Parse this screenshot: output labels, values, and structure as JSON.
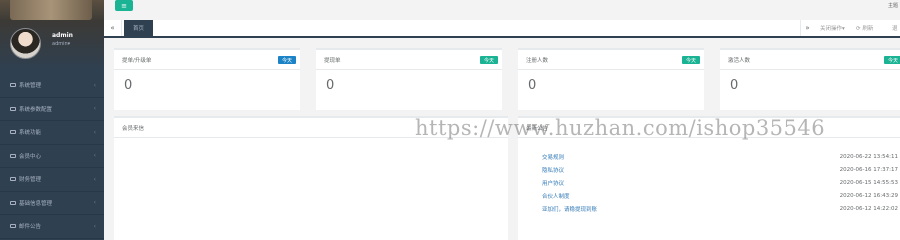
{
  "user": {
    "name": "admin",
    "role": "admin▾"
  },
  "topbar": {
    "menu_icon": "≡",
    "theme_label": "主题"
  },
  "sidebar": {
    "items": [
      {
        "label": "系统管理"
      },
      {
        "label": "系统参数配置"
      },
      {
        "label": "系统功能"
      },
      {
        "label": "会员中心"
      },
      {
        "label": "财务管理"
      },
      {
        "label": "基础信息管理"
      },
      {
        "label": "邮件公告"
      }
    ],
    "arrow": "‹"
  },
  "tabs": {
    "nav_left": "«",
    "active_label": "首页",
    "nav_right": "»",
    "close_ops": "关闭操作▾",
    "refresh": "⟳ 刷新",
    "exit": "退"
  },
  "stats": [
    {
      "title": "提单/升级单",
      "badge": "今天",
      "value": "0",
      "badge_color": "#1c84c6"
    },
    {
      "title": "提现单",
      "badge": "今天",
      "value": "0",
      "badge_color": "#1ab394"
    },
    {
      "title": "注册人数",
      "badge": "今天",
      "value": "0",
      "badge_color": "#1ab394"
    },
    {
      "title": "激活人数",
      "badge": "今天",
      "value": "0",
      "badge_color": "#1ab394"
    }
  ],
  "panels": {
    "messages_title": "会员来信",
    "notices_title": "最新公告",
    "notices": [
      {
        "title": "交易规则",
        "date": "2020-06-22 13:54:11"
      },
      {
        "title": "隐私协议",
        "date": "2020-06-16 17:37:17"
      },
      {
        "title": "用户协议",
        "date": "2020-06-15 14:55:53"
      },
      {
        "title": "合伙人制度",
        "date": "2020-06-12 16:43:29"
      },
      {
        "title": "亚加们，请稳提现到账",
        "date": "2020-06-12 14:22:02"
      }
    ]
  },
  "watermark": "https://www.huzhan.com/ishop35546"
}
